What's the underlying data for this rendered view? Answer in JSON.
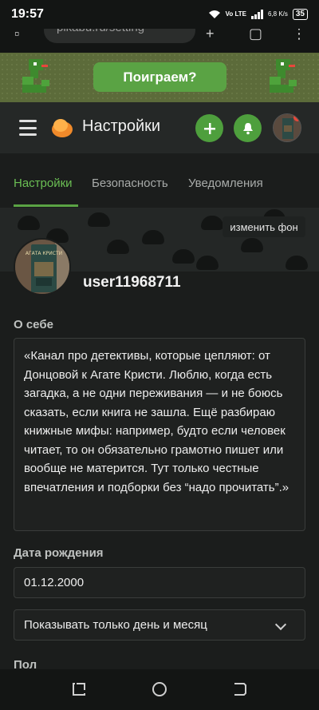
{
  "status": {
    "time": "19:57",
    "network": "Vo LTE",
    "speed": "6,8 K/s",
    "battery": "35"
  },
  "browser": {
    "url": "pikabu.ru/setting"
  },
  "banner": {
    "play_label": "Поиграем?"
  },
  "header": {
    "title": "Настройки"
  },
  "tabs": [
    {
      "label": "Настройки",
      "active": true
    },
    {
      "label": "Безопасность",
      "active": false
    },
    {
      "label": "Уведомления",
      "active": false
    }
  ],
  "cover": {
    "change_bg_label": "изменить фон"
  },
  "profile": {
    "username": "user11968711",
    "book_title": "АГАТА КРИСТИ"
  },
  "about": {
    "label": "О себе",
    "value": "«Канал про детективы, которые цепляют: от Донцовой к Агате Кристи. Люблю, когда есть загадка, а не одни переживания — и не боюсь сказать, если книга не зашла. Ещё разбираю книжные мифы: например, будто если человек читает, то он обязательно грамотно пишет или вообще не матерится. Тут только честные впечатления и подборки без “надо прочитать”.»"
  },
  "birthday": {
    "label": "Дата рождения",
    "value": "01.12.2000",
    "visibility_selected": "Показывать только день и месяц"
  },
  "gender": {
    "label": "Пол"
  },
  "colors": {
    "accent": "#5aa344",
    "bg": "#1b1d1c",
    "header": "#252827"
  }
}
